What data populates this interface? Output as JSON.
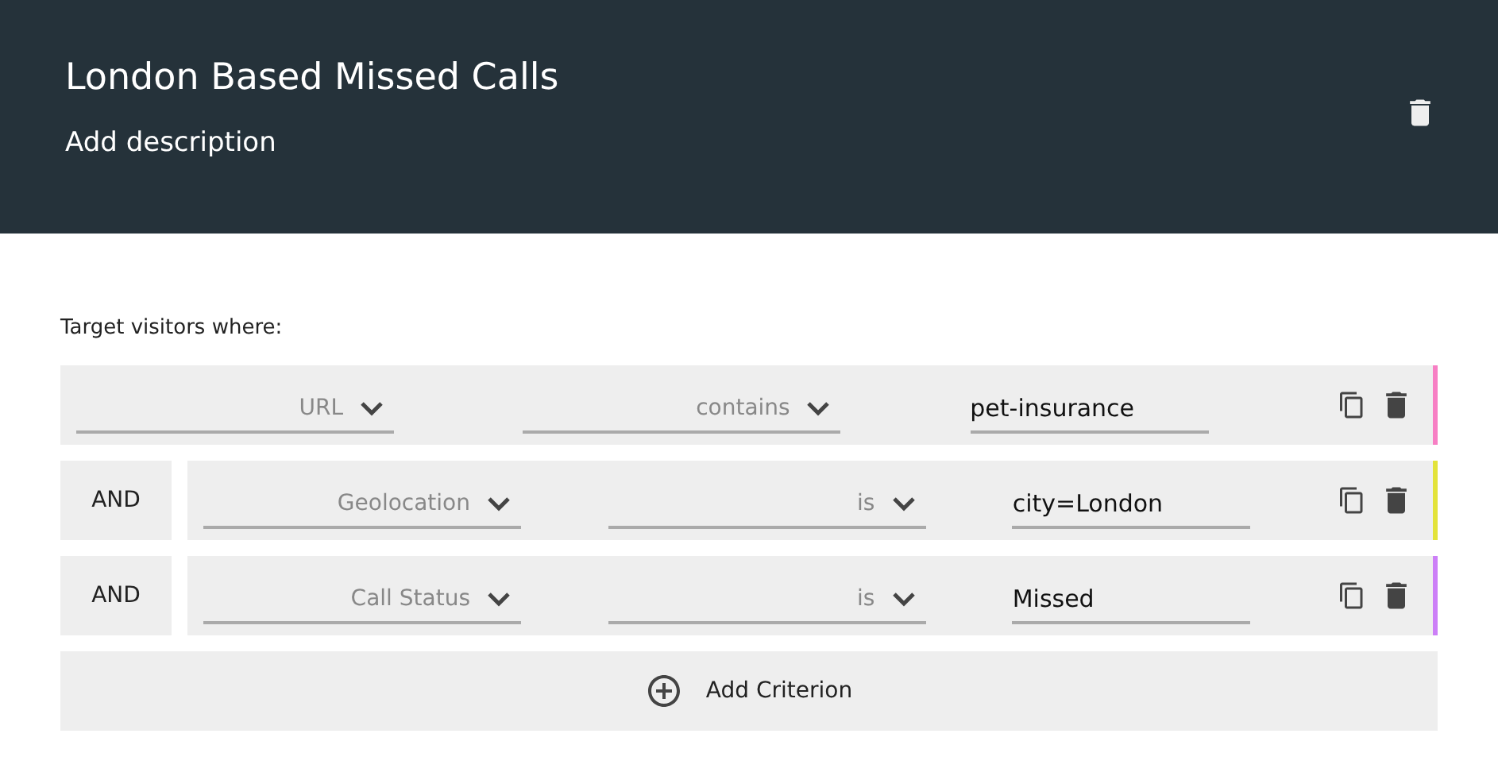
{
  "header": {
    "title": "London Based Missed Calls",
    "description": "Add description"
  },
  "criteria_label": "Target visitors where:",
  "criteria": [
    {
      "attribute": "URL",
      "operator": "contains",
      "value": "pet-insurance",
      "color": "#f77fc4"
    },
    {
      "connector": "AND",
      "attribute": "Geolocation",
      "operator": "is",
      "value": "city=London",
      "color": "#e3e33a"
    },
    {
      "connector": "AND",
      "attribute": "Call Status",
      "operator": "is",
      "value": "Missed",
      "color": "#cc7ff7"
    }
  ],
  "add_button": "Add Criterion"
}
